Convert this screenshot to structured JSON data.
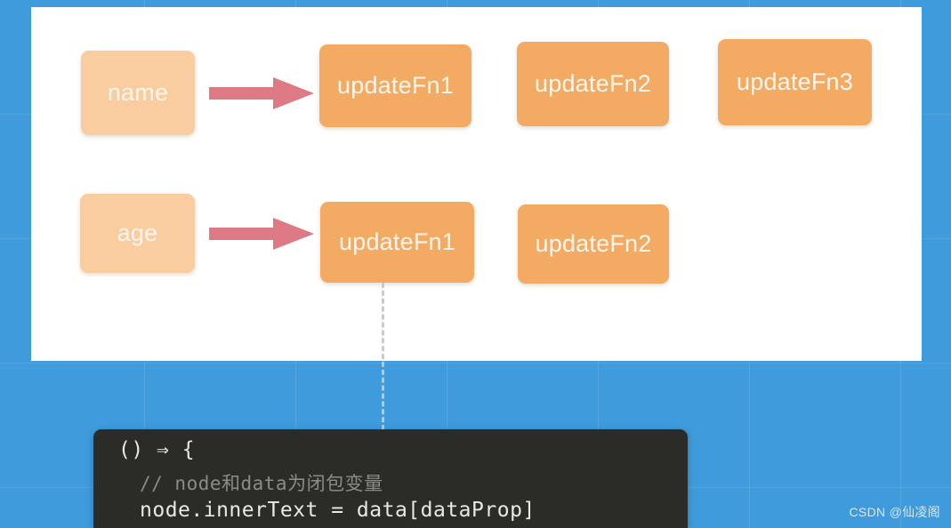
{
  "canvas": {
    "background_color": "#3f9bdc",
    "panel_color": "#ffffff"
  },
  "colors": {
    "blue_background": "#3f9bdc",
    "box_light": "#f9cd9f",
    "box_dark": "#f3ab63",
    "arrow": "#dd7a83",
    "code_background": "#2b2b28",
    "code_text": "#e8e8e4",
    "code_comment": "#8c8c84",
    "dashed_line": "#c9c9c9"
  },
  "diagram": {
    "rows": [
      {
        "source": {
          "label": "name",
          "style": "light"
        },
        "arrow": {
          "name": "arrow-name-to-updatefn1"
        },
        "handlers": [
          {
            "label": "updateFn1",
            "style": "dark"
          },
          {
            "label": "updateFn2",
            "style": "dark"
          },
          {
            "label": "updateFn3",
            "style": "dark"
          }
        ]
      },
      {
        "source": {
          "label": "age",
          "style": "light"
        },
        "arrow": {
          "name": "arrow-age-to-updatefn1"
        },
        "handlers": [
          {
            "label": "updateFn1",
            "style": "dark"
          },
          {
            "label": "updateFn2",
            "style": "dark"
          }
        ]
      }
    ],
    "connector": {
      "style": "dashed",
      "from": "age-updateFn1",
      "to": "code-block"
    }
  },
  "code_block": {
    "lines": [
      "() ⇒ {",
      "// node和data为闭包变量",
      "node.innerText = data[dataProp]"
    ]
  },
  "watermark": {
    "text": "CSDN @仙凌阁"
  }
}
